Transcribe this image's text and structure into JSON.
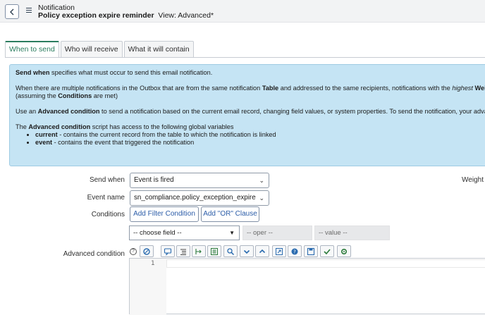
{
  "header": {
    "line1": "Notification",
    "record_name": "Policy exception expire reminder",
    "view_label": "View: Advanced*"
  },
  "tabs": [
    {
      "label": "When to send",
      "active": true
    },
    {
      "label": "Who will receive",
      "active": false
    },
    {
      "label": "What it will contain",
      "active": false
    }
  ],
  "info": {
    "p1_bold": "Send when",
    "p1_rest": " specifies what must occur to send this email notification.",
    "p2_a": "When there are multiple notifications in the Outbox that are from the same notification ",
    "p2_b_bold": "Table",
    "p2_c": " and addressed to the same recipients, notifications with the ",
    "p2_d_italic": "highest",
    "p2_e_bold": " Weight",
    "p2_line2_a": "(assuming the ",
    "p2_line2_b_bold": "Conditions",
    "p2_line2_c": " are met)",
    "p3_a": "Use an ",
    "p3_b_bold": "Advanced condition",
    "p3_c": " to send a notification based on the current email record, changing field values, or system properties. To send the notification, your advanced c",
    "p4_a": "The ",
    "p4_b_bold": "Advanced condition",
    "p4_c": " script has access to the following global variables",
    "bullets": [
      {
        "bold": "current",
        "rest": " - contains the current record from the table to which the notification is linked"
      },
      {
        "bold": "event",
        "rest": " - contains the event that triggered the notification"
      }
    ]
  },
  "form": {
    "send_when_label": "Send when",
    "send_when_value": "Event is fired",
    "weight_label": "Weight",
    "event_name_label": "Event name",
    "event_name_value": "sn_compliance.policy_exception_expire",
    "conditions_label": "Conditions",
    "add_filter_label": "Add Filter Condition",
    "add_or_label": "Add \"OR\" Clause",
    "choose_field": "-- choose field --",
    "oper": "-- oper --",
    "value": "-- value --",
    "advanced_condition_label": "Advanced condition",
    "line_number": "1"
  },
  "colors": {
    "accent_green": "#2b7d5f",
    "info_bg": "#c5e4f4",
    "button_text": "#2b5ca8"
  }
}
